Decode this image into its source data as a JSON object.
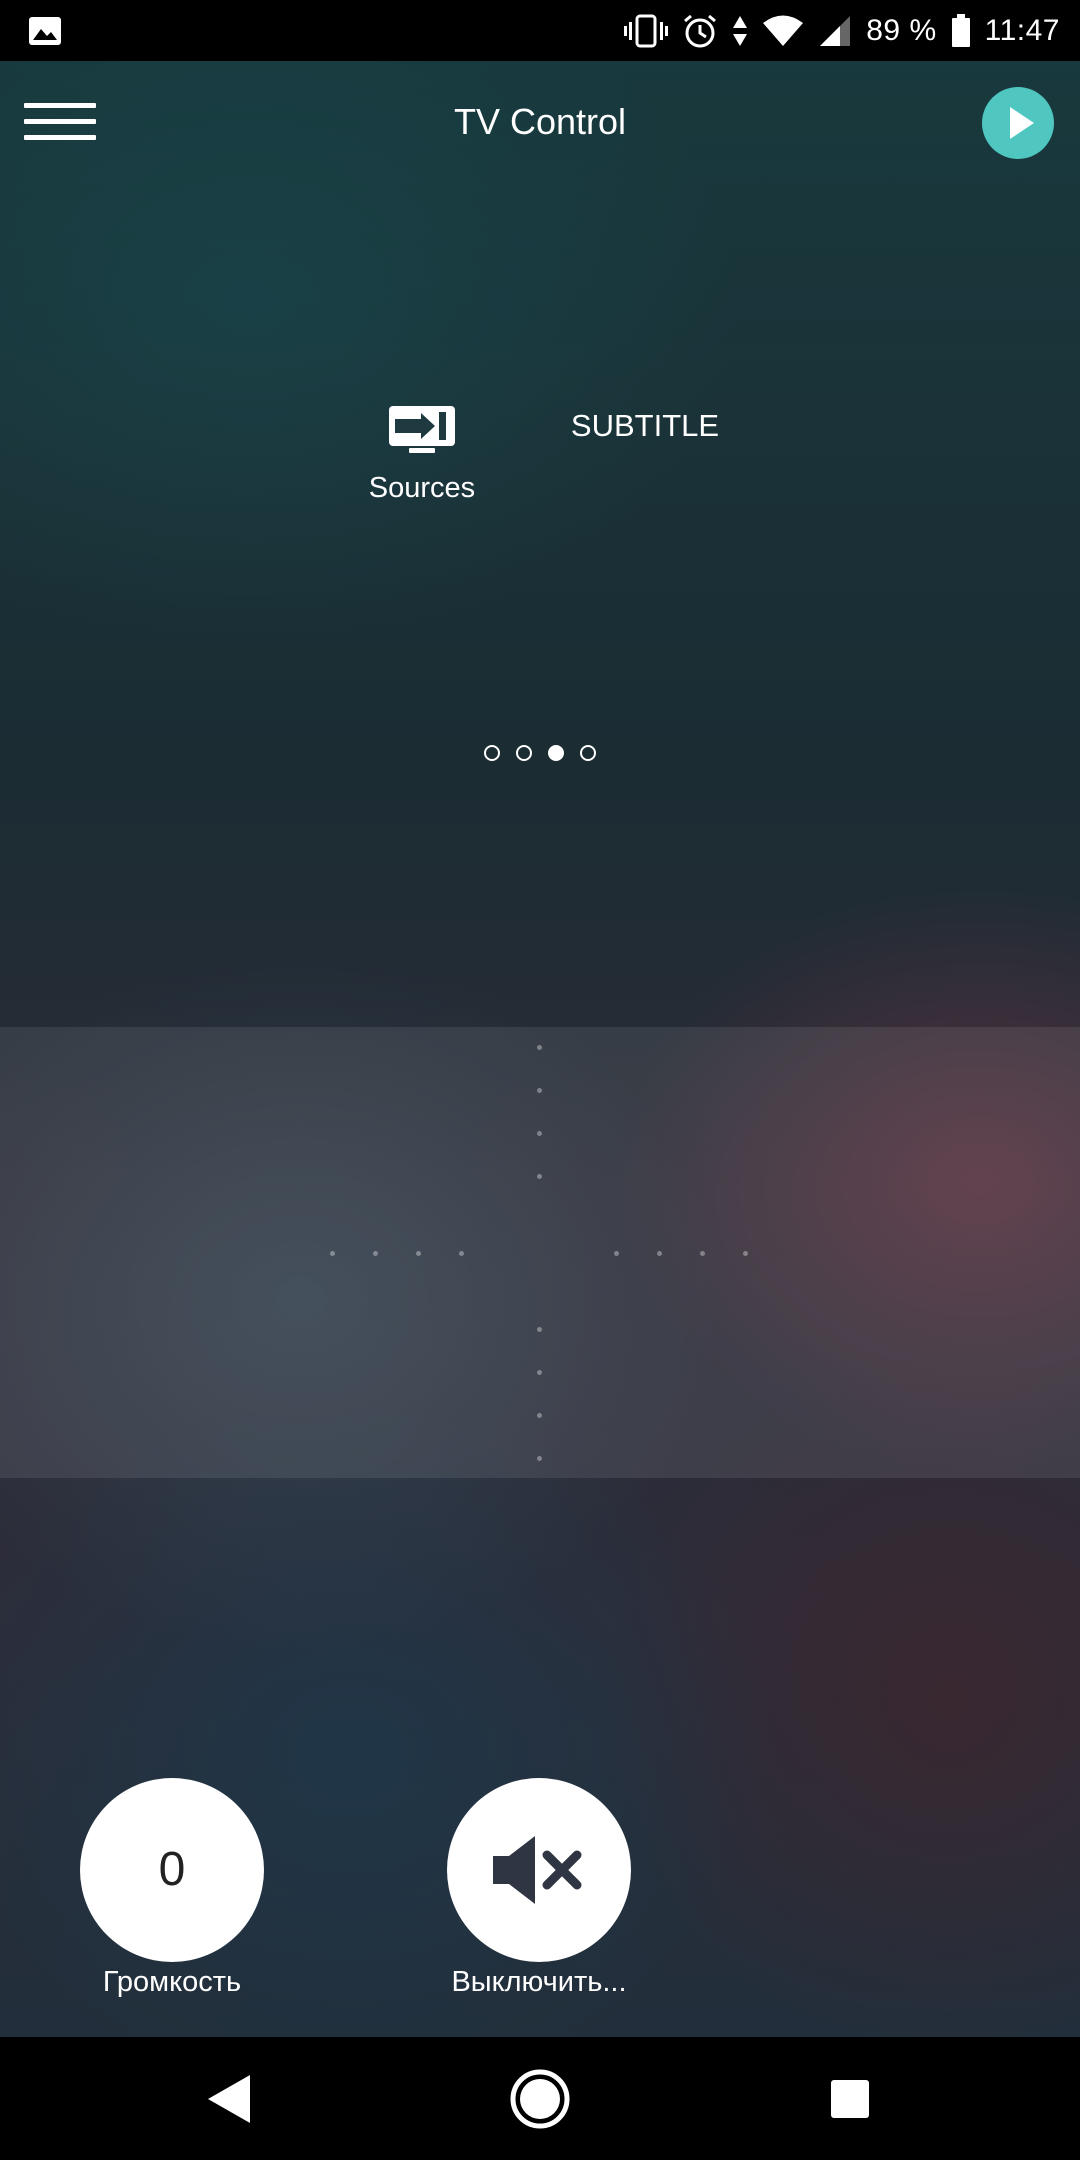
{
  "status_bar": {
    "battery_percent": "89 %",
    "time": "11:47",
    "icons": [
      "image-notification-icon",
      "vibrate-icon",
      "alarm-icon",
      "data-arrows-icon",
      "wifi-icon",
      "signal-icon",
      "battery-icon"
    ]
  },
  "app_bar": {
    "title": "TV Control",
    "menu_icon": "hamburger-menu-icon",
    "play_icon": "play-icon",
    "accent_color": "#4fc6c0"
  },
  "controls": {
    "sources_label": "Sources",
    "sources_icon": "input-source-icon",
    "subtitle_label": "SUBTITLE"
  },
  "pager": {
    "count": 4,
    "active_index": 2
  },
  "bottom": {
    "volume_value": "0",
    "volume_label": "Громкость",
    "mute_label": "Выключить...",
    "mute_icon": "mute-speaker-icon"
  },
  "nav_bar": {
    "icons": [
      "back-icon",
      "home-icon",
      "recents-icon"
    ]
  }
}
